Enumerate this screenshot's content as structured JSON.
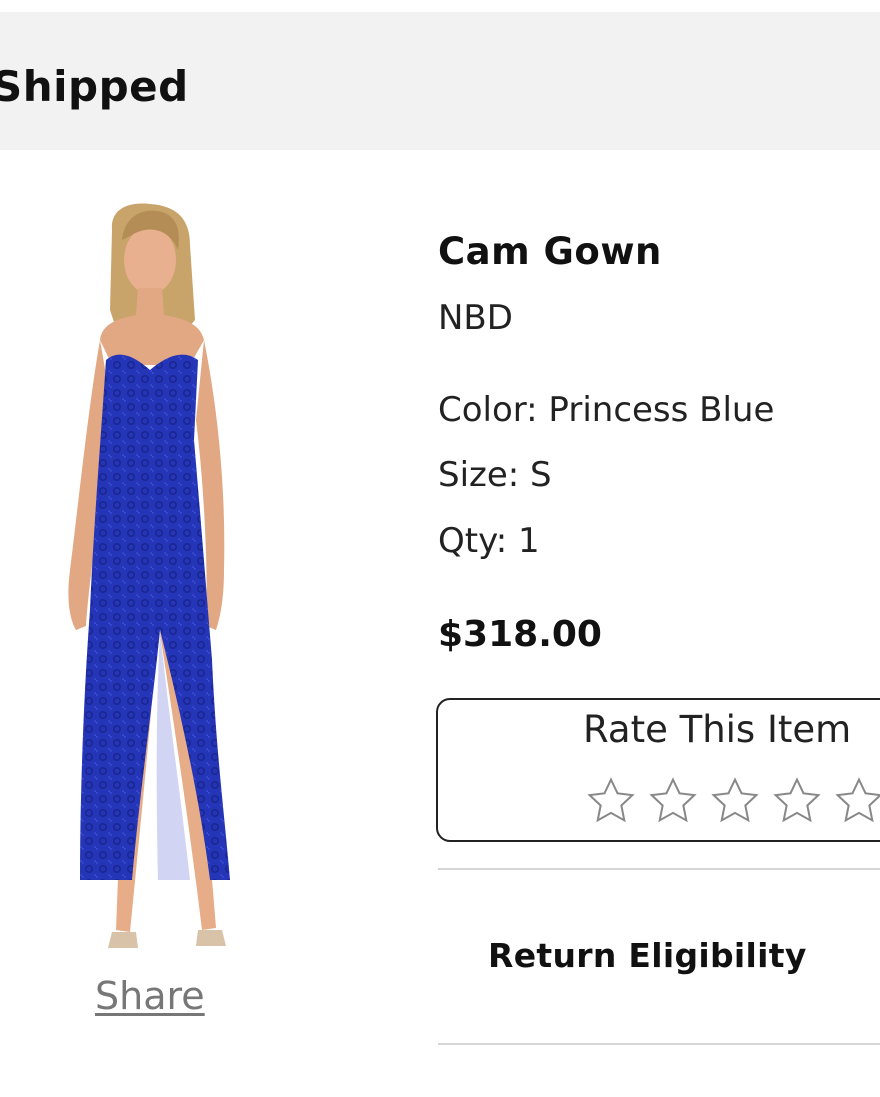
{
  "header": {
    "status_text": "Shipped"
  },
  "product": {
    "name": "Cam Gown",
    "brand": "NBD",
    "color_line": "Color: Princess Blue",
    "size_line": "Size: S",
    "qty_line": "Qty: 1",
    "price": "$318.00",
    "dress_color": "#2535b8",
    "share_label": "Share"
  },
  "rating": {
    "label": "Rate This Item",
    "stars_total": 5,
    "stars_selected": 0,
    "star_icon": "star-outline-icon"
  },
  "returns": {
    "label": "Return Eligibility"
  }
}
